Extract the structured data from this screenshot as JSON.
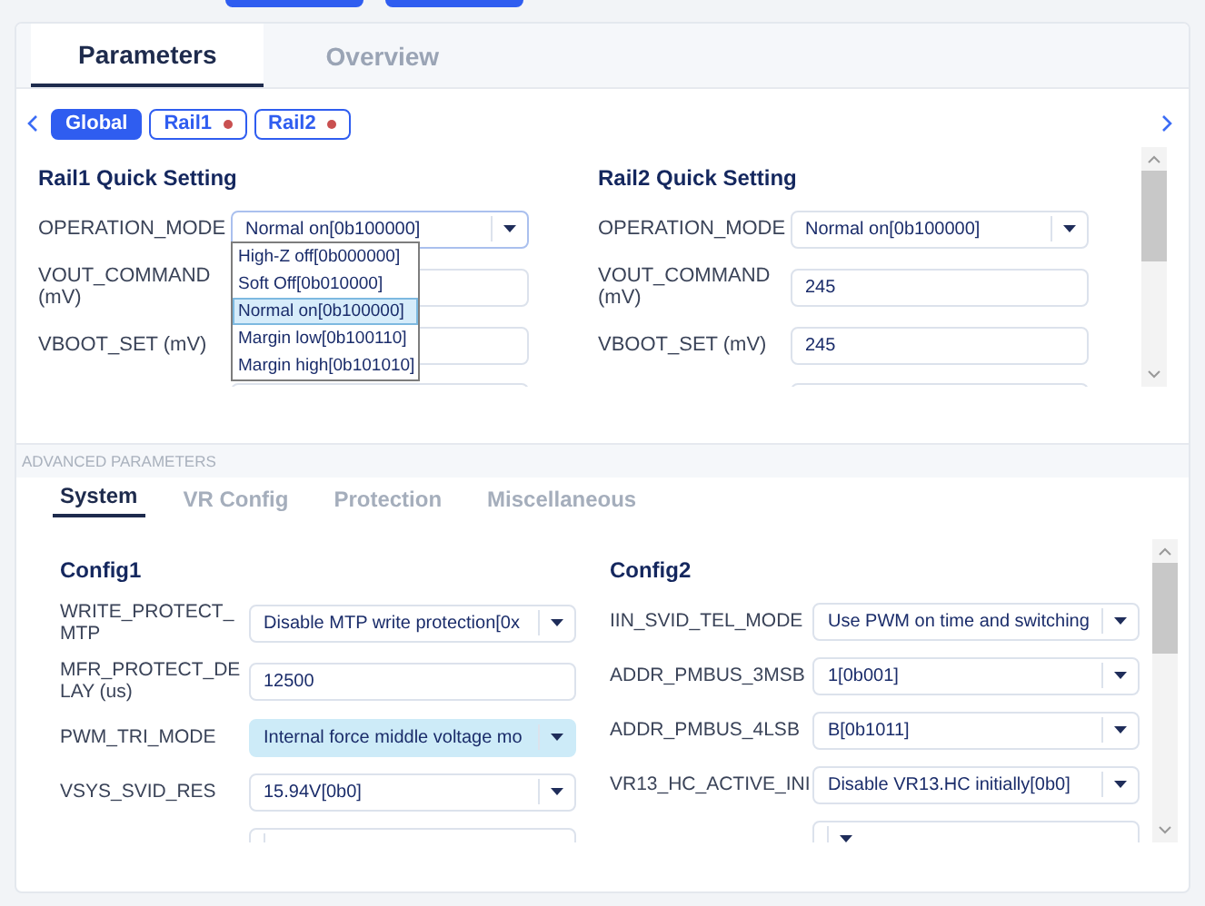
{
  "tabs": [
    {
      "label": "Parameters",
      "selected": true
    },
    {
      "label": "Overview",
      "selected": false
    }
  ],
  "rail_tabs": [
    {
      "label": "Global",
      "selected": true,
      "alert": false
    },
    {
      "label": "Rail1",
      "selected": false,
      "alert": true
    },
    {
      "label": "Rail2",
      "selected": false,
      "alert": true
    }
  ],
  "quick_settings": [
    {
      "title": "Rail1 Quick Setting",
      "rows": [
        {
          "kind": "select",
          "label": "OPERATION_MODE",
          "value": "Normal on[0b100000]",
          "open": true,
          "options": [
            {
              "label": "High-Z off[0b000000]",
              "selected": false
            },
            {
              "label": "Soft Off[0b010000]",
              "selected": false
            },
            {
              "label": "Normal on[0b100000]",
              "selected": true
            },
            {
              "label": "Margin low[0b100110]",
              "selected": false
            },
            {
              "label": "Margin high[0b101010]",
              "selected": false
            }
          ]
        },
        {
          "kind": "input",
          "label": "VOUT_COMMAND (mV)"
        },
        {
          "kind": "input",
          "label": "VBOOT_SET (mV)"
        },
        {
          "kind": "input"
        }
      ]
    },
    {
      "title": "Rail2 Quick Setting",
      "rows": [
        {
          "kind": "select",
          "label": "OPERATION_MODE",
          "value": "Normal on[0b100000]",
          "open": false
        },
        {
          "kind": "input",
          "label": "VOUT_COMMAND (mV)",
          "value": "245"
        },
        {
          "kind": "input",
          "label": "VBOOT_SET (mV)",
          "value": "245"
        },
        {
          "kind": "input"
        }
      ]
    }
  ],
  "advanced": {
    "title": "ADVANCED PARAMETERS",
    "tabs": [
      {
        "label": "System",
        "selected": true
      },
      {
        "label": "VR Config",
        "selected": false
      },
      {
        "label": "Protection",
        "selected": false
      },
      {
        "label": "Miscellaneous",
        "selected": false
      }
    ],
    "configs": [
      {
        "title": "Config1",
        "rows": [
          {
            "kind": "select",
            "label": "WRITE_PROTECT_MTP",
            "value": "Disable MTP write protection[0x",
            "highlighted": false
          },
          {
            "kind": "input",
            "label": "MFR_PROTECT_DELAY (us)",
            "value": "12500"
          },
          {
            "kind": "select",
            "label": "PWM_TRI_MODE",
            "value": "Internal force middle voltage mo",
            "highlighted": true
          },
          {
            "kind": "select",
            "label": "VSYS_SVID_RES",
            "value": "15.94V[0b0]",
            "highlighted": false
          },
          {
            "kind": "select"
          }
        ]
      },
      {
        "title": "Config2",
        "rows": [
          {
            "kind": "select",
            "label": "IIN_SVID_TEL_MODE",
            "value": "Use PWM on time and switching",
            "highlighted": false
          },
          {
            "kind": "select",
            "label": "ADDR_PMBUS_3MSB",
            "value": "1[0b001]",
            "highlighted": false
          },
          {
            "kind": "select",
            "label": "ADDR_PMBUS_4LSB",
            "value": "B[0b1011]",
            "highlighted": false
          },
          {
            "kind": "select",
            "label": "VR13_HC_ACTIVE_INI",
            "value": "Disable VR13.HC initially[0b0]",
            "highlighted": false
          },
          {
            "kind": "select"
          }
        ]
      }
    ]
  }
}
